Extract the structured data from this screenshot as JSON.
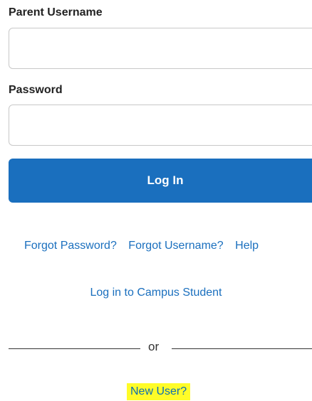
{
  "form": {
    "username_label": "Parent Username",
    "username_value": "",
    "password_label": "Password",
    "password_value": "",
    "login_button_label": "Log In"
  },
  "links": {
    "forgot_password": "Forgot Password?",
    "forgot_username": "Forgot Username?",
    "help": "Help",
    "campus_student": "Log in to Campus Student",
    "new_user": "New User?"
  },
  "divider": {
    "text": "or"
  },
  "colors": {
    "accent": "#1a6fbe",
    "highlight": "#fffc28",
    "input_border": "#c8c8c8"
  }
}
